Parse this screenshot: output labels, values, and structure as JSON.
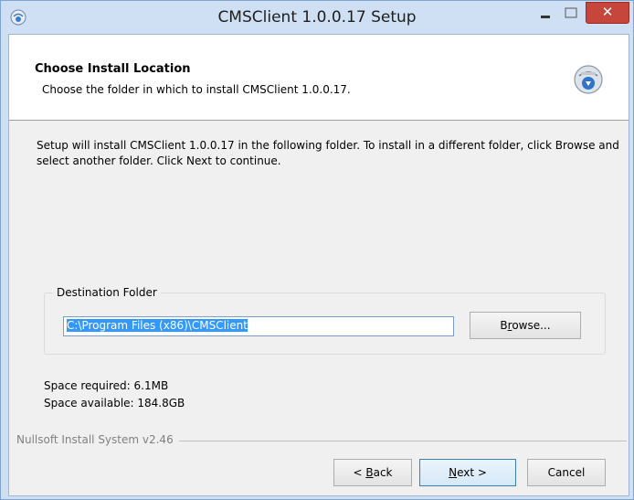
{
  "window": {
    "title": "CMSClient 1.0.0.17 Setup",
    "minimize_glyph": "–",
    "maximize_glyph": "□",
    "close_glyph": "✕"
  },
  "header": {
    "title": "Choose Install Location",
    "subtitle": "Choose the folder in which to install CMSClient 1.0.0.17."
  },
  "intro_text": "Setup will install CMSClient 1.0.0.17 in the following folder. To install in a different folder, click Browse and select another folder. Click Next to continue.",
  "destination": {
    "group_label": "Destination Folder",
    "path_value": "C:\\Program Files (x86)\\CMSClient",
    "browse_pre": "B",
    "browse_accel": "r",
    "browse_post": "owse..."
  },
  "space": {
    "required": "Space required: 6.1MB",
    "available": "Space available: 184.8GB"
  },
  "footer": {
    "branding": "Nullsoft Install System v2.46"
  },
  "buttons": {
    "back_pre": "< ",
    "back_accel": "B",
    "back_post": "ack",
    "next_accel": "N",
    "next_post": "ext >",
    "cancel": "Cancel"
  },
  "colors": {
    "close_button": "#c7463b",
    "selection": "#3399ff",
    "window_frame": "#cfe0f5"
  },
  "icons": {
    "app": "installer-globe-icon",
    "header": "install-disc-icon"
  }
}
